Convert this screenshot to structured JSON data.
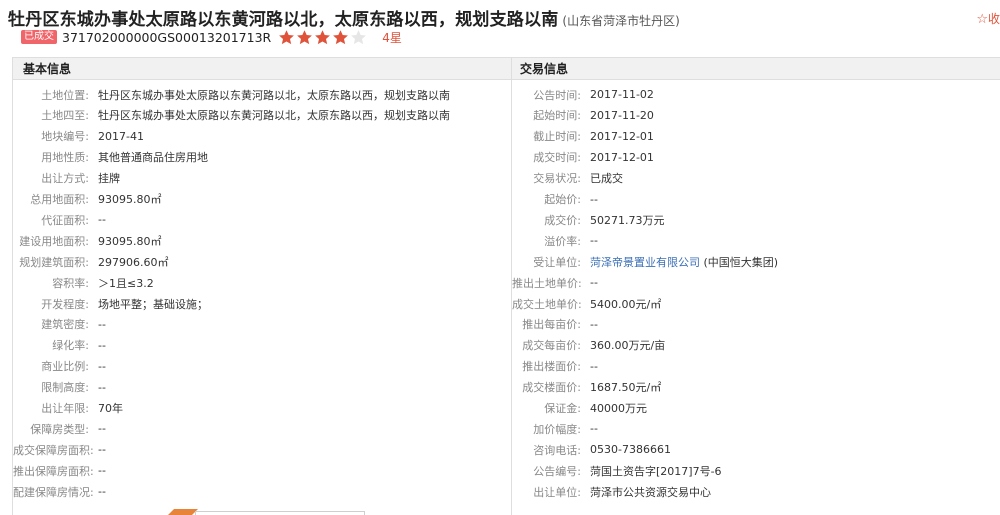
{
  "title": {
    "main": "牡丹区东城办事处太原路以东黄河路以北，太原东路以西，规划支路以南",
    "region": "(山东省菏泽市牡丹区)"
  },
  "favorite": {
    "icon": "star-outline-icon",
    "label": "收"
  },
  "meta": {
    "badge": "已成交",
    "code": "371702000000GS00013201713R",
    "rating_value": 4,
    "rating_max": 5,
    "rating_text": "4星"
  },
  "colors": {
    "accent": "#e0533b",
    "badge": "#f0656a",
    "link": "#3a6fb7"
  },
  "basic": {
    "heading": "基本信息",
    "rows": [
      {
        "label": "土地位置:",
        "value": "牡丹区东城办事处太原路以东黄河路以北，太原东路以西，规划支路以南"
      },
      {
        "label": "土地四至:",
        "value": "牡丹区东城办事处太原路以东黄河路以北，太原东路以西，规划支路以南"
      },
      {
        "label": "地块编号:",
        "value": "2017-41"
      },
      {
        "label": "用地性质:",
        "value": "其他普通商品住房用地"
      },
      {
        "label": "出让方式:",
        "value": "挂牌"
      },
      {
        "label": "总用地面积:",
        "value": "93095.80㎡"
      },
      {
        "label": "代征面积:",
        "value": "--"
      },
      {
        "label": "建设用地面积:",
        "value": "93095.80㎡"
      },
      {
        "label": "规划建筑面积:",
        "value": "297906.60㎡"
      },
      {
        "label": "容积率:",
        "value": "＞1且≤3.2"
      },
      {
        "label": "开发程度:",
        "value": "场地平整；基础设施；"
      },
      {
        "label": "建筑密度:",
        "value": "--"
      },
      {
        "label": "绿化率:",
        "value": "--"
      },
      {
        "label": "商业比例:",
        "value": "--"
      },
      {
        "label": "限制高度:",
        "value": "--"
      },
      {
        "label": "出让年限:",
        "value": "70年"
      },
      {
        "label": "保障房类型:",
        "value": "--"
      },
      {
        "label": "成交保障房面积:",
        "value": "--"
      },
      {
        "label": "推出保障房面积:",
        "value": "--"
      },
      {
        "label": "配建保障房情况:",
        "value": "--"
      }
    ]
  },
  "trade": {
    "heading": "交易信息",
    "rows": [
      {
        "label": "公告时间:",
        "value": "2017-11-02"
      },
      {
        "label": "起始时间:",
        "value": "2017-11-20"
      },
      {
        "label": "截止时间:",
        "value": "2017-12-01"
      },
      {
        "label": "成交时间:",
        "value": "2017-12-01"
      },
      {
        "label": "交易状况:",
        "value": "已成交"
      },
      {
        "label": "起始价:",
        "value": "--"
      },
      {
        "label": "成交价:",
        "value": "50271.73万元"
      },
      {
        "label": "溢价率:",
        "value": "--"
      },
      {
        "label": "受让单位:",
        "value": "菏泽帝景置业有限公司",
        "extra": "(中国恒大集团)"
      },
      {
        "label": "推出土地单价:",
        "value": "--"
      },
      {
        "label": "成交土地单价:",
        "value": "5400.00元/㎡"
      },
      {
        "label": "推出每亩价:",
        "value": "--"
      },
      {
        "label": "成交每亩价:",
        "value": "360.00万元/亩"
      },
      {
        "label": "推出楼面价:",
        "value": "--"
      },
      {
        "label": "成交楼面价:",
        "value": "1687.50元/㎡"
      },
      {
        "label": "保证金:",
        "value": "40000万元"
      },
      {
        "label": "加价幅度:",
        "value": "--"
      },
      {
        "label": "咨询电话:",
        "value": "0530-7386661"
      },
      {
        "label": "公告编号:",
        "value": "菏国土资告字[2017]7号-6"
      },
      {
        "label": "出让单位:",
        "value": "菏泽市公共资源交易中心"
      }
    ]
  }
}
